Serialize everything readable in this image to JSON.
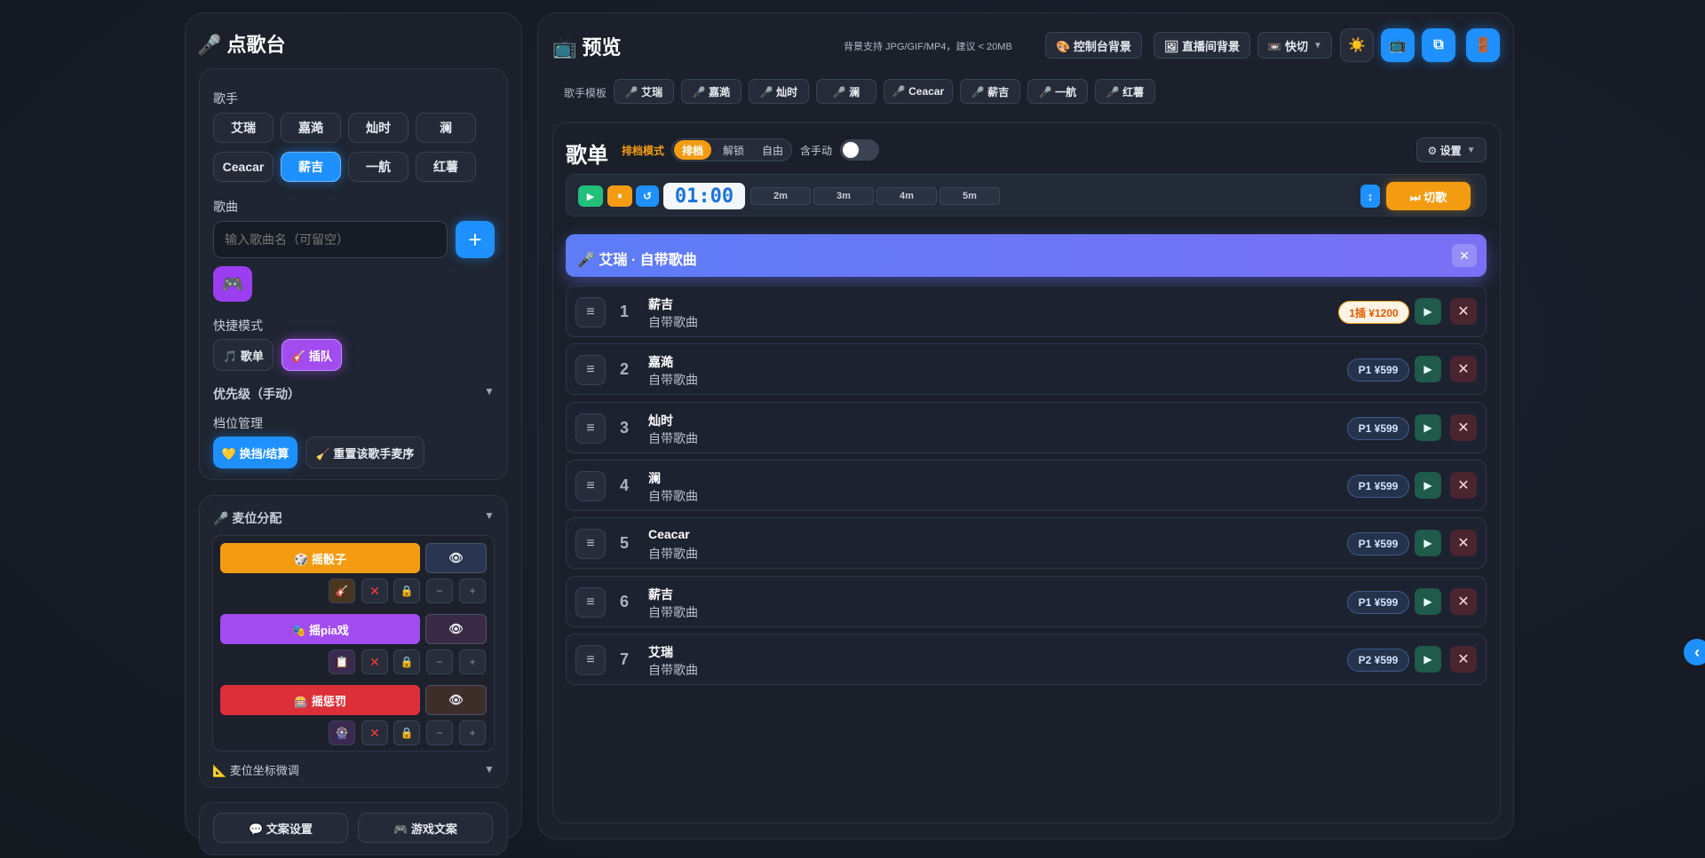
{
  "left": {
    "title": "🎤 点歌台",
    "singer_label": "歌手",
    "singers": [
      "艾瑞",
      "嘉澔",
      "灿时",
      "澜",
      "Ceacar",
      "薪吉",
      "一航",
      "红薯"
    ],
    "selected_singer": "薪吉",
    "song_label": "歌曲",
    "song_placeholder": "输入歌曲名（可留空）",
    "add_label": "+",
    "game_icon": "🎮",
    "quick_mode_label": "快捷模式",
    "quick_modes": [
      "🎵 歌单",
      "🎸 插队"
    ],
    "priority_label": "优先级（手动）",
    "priority_arrow": "▼",
    "slot_label": "档位管理",
    "slot_btn1": "💛 换挡/结算",
    "slot_btn2": "🧹 重置该歌手麦序",
    "mic_title": "🎤 麦位分配",
    "mic_arrow": "▼",
    "mic_rows": [
      {
        "label": "🎲 摇骰子",
        "eye": "👁",
        "icon": "🎸"
      },
      {
        "label": "🎭 摇pia戏",
        "eye": "👁",
        "icon": "📋"
      },
      {
        "label": "🎰 摇惩罚",
        "eye": "👁",
        "icon": "🎡"
      }
    ],
    "ctrl_x": "✕",
    "ctrl_lock": "🔒",
    "ctrl_minus": "−",
    "ctrl_plus": "+",
    "coord_label": "📐 麦位坐标微调",
    "coord_arrow": "▼",
    "copy_btn": "💬 文案设置",
    "game_copy_btn": "🎮 游戏文案"
  },
  "right": {
    "title": "📺 预览",
    "bg_hint": "背景支持 JPG/GIF/MP4，建议 < 20MB",
    "btn_console_bg": "🎨 控制台背景",
    "btn_live_bg": "🖼 直播间背景",
    "btn_quick": "📼 快切",
    "quick_arrow": "▼",
    "icons": [
      "☀️",
      "📺",
      "⧉",
      "🚪"
    ],
    "template_label": "歌手模板",
    "templates": [
      "🎤 艾瑞",
      "🎤 嘉澔",
      "🎤 灿时",
      "🎤 澜",
      "🎤 Ceacar",
      "🎤 薪吉",
      "🎤 一航",
      "🎤 红薯"
    ],
    "playlist_title": "歌单",
    "mode_label": "排档模式",
    "modes": [
      "排档",
      "解锁",
      "自由"
    ],
    "hand_label": "含手动",
    "settings": "⚙ 设置",
    "settings_arrow": "▼",
    "timer": "01:00",
    "durations": [
      "2m",
      "3m",
      "4m",
      "5m"
    ],
    "ctrl_play": "▶",
    "ctrl_pause": "⏸",
    "ctrl_reset": "↺",
    "ctrl_sort": "↕",
    "cut_song": "⏭ 切歌",
    "current_banner": "🎤 艾瑞 · 自带歌曲",
    "banner_close": "✕",
    "songs": [
      {
        "n": "1",
        "name": "薪吉",
        "sub": "自带歌曲",
        "price": "1插 ¥1200"
      },
      {
        "n": "2",
        "name": "嘉澔",
        "sub": "自带歌曲",
        "price": "P1 ¥599"
      },
      {
        "n": "3",
        "name": "灿时",
        "sub": "自带歌曲",
        "price": "P1 ¥599"
      },
      {
        "n": "4",
        "name": "澜",
        "sub": "自带歌曲",
        "price": "P1 ¥599"
      },
      {
        "n": "5",
        "name": "Ceacar",
        "sub": "自带歌曲",
        "price": "P1 ¥599"
      },
      {
        "n": "6",
        "name": "薪吉",
        "sub": "自带歌曲",
        "price": "P1 ¥599"
      },
      {
        "n": "7",
        "name": "艾瑞",
        "sub": "自带歌曲",
        "price": "P2 ¥599"
      }
    ],
    "row_handle": "≡",
    "row_play": "▶",
    "row_del": "✕",
    "side_toggle": "‹"
  },
  "colors": {
    "accent_blue": "#1e90ff",
    "orange": "#f39c12",
    "purple": "#9b59f6",
    "red": "#dc2f3a",
    "banner": "#6b7bff"
  }
}
